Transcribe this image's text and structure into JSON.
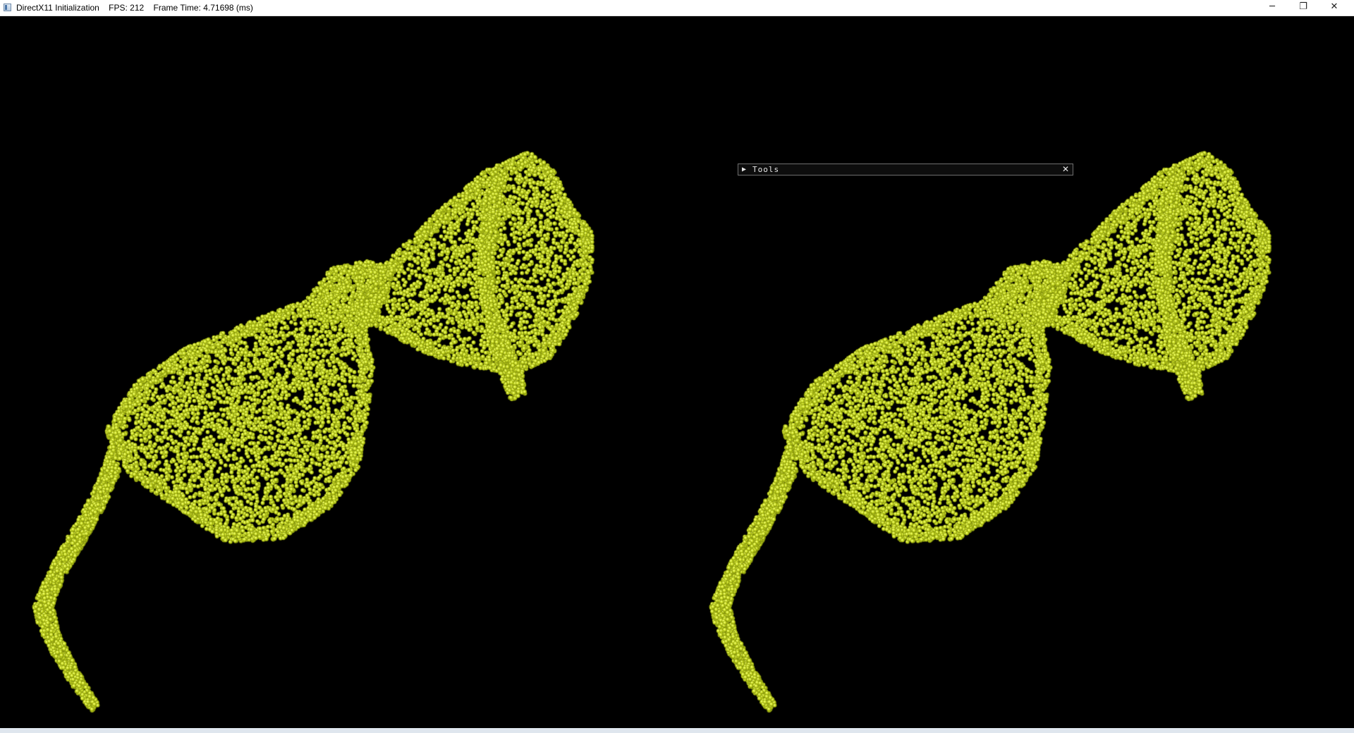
{
  "window": {
    "title": "DirectX11 Initialization    FPS: 212    Frame Time: 4.71698 (ms)",
    "controls": {
      "minimize": "─",
      "restore": "❐",
      "close": "✕"
    }
  },
  "tools_panel": {
    "arrow": "▶",
    "title": "Tools",
    "close": "✕"
  },
  "scene": {
    "background_color": "#000000",
    "point_color": "#c6d91c",
    "models": [
      "sunglasses-point-cloud-left",
      "sunglasses-point-cloud-right"
    ]
  }
}
